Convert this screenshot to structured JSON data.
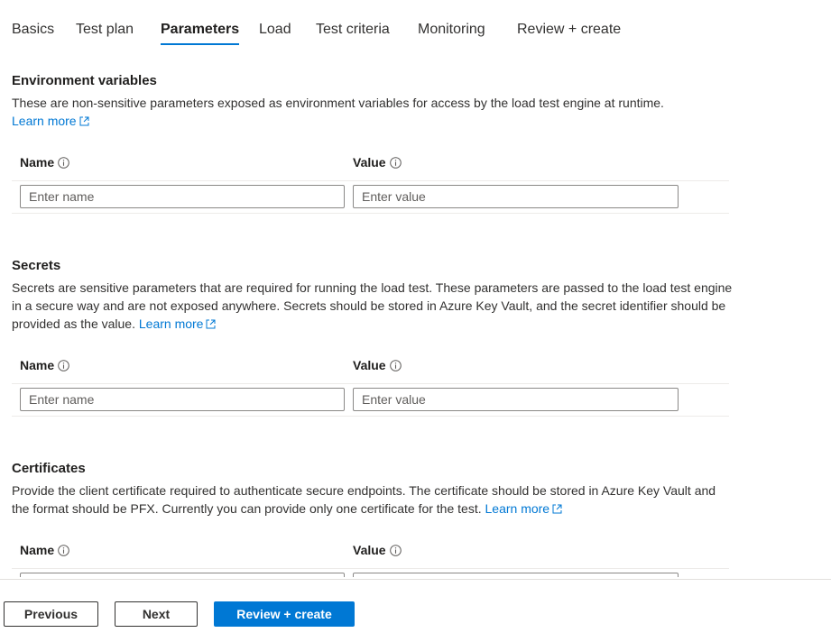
{
  "tabs": [
    {
      "label": "Basics",
      "active": false
    },
    {
      "label": "Test plan",
      "active": false
    },
    {
      "label": "Parameters",
      "active": true
    },
    {
      "label": "Load",
      "active": false
    },
    {
      "label": "Test criteria",
      "active": false
    },
    {
      "label": "Monitoring",
      "active": false
    },
    {
      "label": "Review + create",
      "active": false
    }
  ],
  "env": {
    "title": "Environment variables",
    "description": "These are non-sensitive parameters exposed as environment variables for access by the load test engine at runtime.",
    "learn_more": "Learn more",
    "name_header": "Name",
    "value_header": "Value",
    "name_placeholder": "Enter name",
    "value_placeholder": "Enter value"
  },
  "secrets": {
    "title": "Secrets",
    "description": "Secrets are sensitive parameters that are required for running the load test. These parameters are passed to the load test engine in a secure way and are not exposed anywhere. Secrets should be stored in Azure Key Vault, and the secret identifier should be provided as the value.",
    "learn_more": "Learn more",
    "name_header": "Name",
    "value_header": "Value",
    "name_placeholder": "Enter name",
    "value_placeholder": "Enter value"
  },
  "certificates": {
    "title": "Certificates",
    "description": "Provide the client certificate required to authenticate secure endpoints. The certificate should be stored in Azure Key Vault and the format should be PFX. Currently you can provide only one certificate for the test.",
    "learn_more": "Learn more",
    "name_header": "Name",
    "value_header": "Value"
  },
  "footer": {
    "previous": "Previous",
    "next": "Next",
    "review_create": "Review + create"
  },
  "colors": {
    "accent": "#0078d4",
    "text": "#323130",
    "border": "#8a8886"
  }
}
